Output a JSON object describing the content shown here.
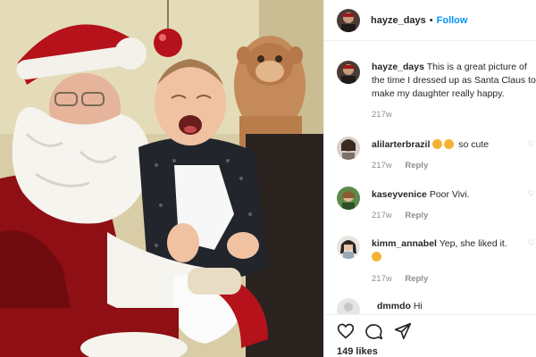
{
  "post": {
    "author": "hayze_days",
    "dot": "•",
    "follow_label": "Follow",
    "caption_author": "hayze_days",
    "caption_text": "This is a great picture of the time I dressed up as Santa Claus to make my daughter really happy.",
    "caption_time": "217w",
    "likes": "149 likes"
  },
  "comments": [
    {
      "user": "alilarterbrazil",
      "text": "so cute",
      "time": "217w",
      "reply": "Reply",
      "emojis": 2
    },
    {
      "user": "kaseyvenice",
      "text": "Poor Vivi.",
      "time": "217w",
      "reply": "Reply"
    },
    {
      "user": "kimm_annabel",
      "text": "Yep, she liked it.",
      "time": "217w",
      "reply": "Reply",
      "emojis": 1
    },
    {
      "user": "dmmdo",
      "text": "Hi"
    }
  ],
  "icons": {
    "like": "heart-icon",
    "comment": "comment-icon",
    "share": "share-icon",
    "comment_like": "small-heart-icon"
  },
  "colors": {
    "follow": "#0095f6",
    "muted": "#8e8e8e",
    "emoji": "#f5b335"
  }
}
